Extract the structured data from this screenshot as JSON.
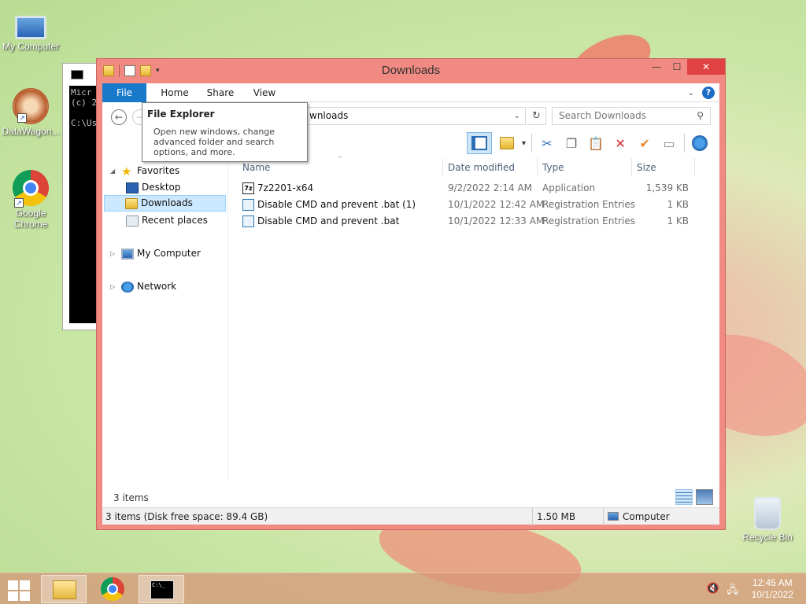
{
  "desktop": {
    "icons": [
      {
        "label": "My Computer",
        "icon": "computer-icon"
      },
      {
        "label": "DataWagon...",
        "icon": "datawagon-icon"
      },
      {
        "label": "Google Chrome",
        "icon": "chrome-icon"
      },
      {
        "label": "Recycle Bin",
        "icon": "recycle-bin-icon"
      }
    ]
  },
  "cmd_window": {
    "lines": [
      "Micr",
      "(c) 2",
      "",
      "C:\\Us"
    ]
  },
  "explorer": {
    "title": "Downloads",
    "window_buttons": {
      "minimize": "—",
      "maximize": "☐",
      "close": "✕"
    },
    "ribbon_tabs": [
      "File",
      "Home",
      "Share",
      "View"
    ],
    "address": "wnloads",
    "search_placeholder": "Search Downloads",
    "nav": {
      "favorites": "Favorites",
      "desktop": "Desktop",
      "downloads": "Downloads",
      "recent": "Recent places",
      "my_computer": "My Computer",
      "network": "Network"
    },
    "columns": [
      "Name",
      "Date modified",
      "Type",
      "Size"
    ],
    "files": [
      {
        "name": "7z2201-x64",
        "date": "9/2/2022 2:14 AM",
        "type": "Application",
        "size": "1,539 KB",
        "icon": "7zip-icon"
      },
      {
        "name": "Disable CMD and prevent .bat (1)",
        "date": "10/1/2022 12:42 AM",
        "type": "Registration Entries",
        "size": "1 KB",
        "icon": "registry-icon"
      },
      {
        "name": "Disable CMD and prevent .bat",
        "date": "10/1/2022 12:33 AM",
        "type": "Registration Entries",
        "size": "1 KB",
        "icon": "registry-icon"
      }
    ],
    "items_count": "3 items",
    "status": {
      "left": "3 items (Disk free space: 89.4 GB)",
      "size": "1.50 MB",
      "location": "Computer"
    },
    "tooltip": {
      "title": "File Explorer",
      "body": "Open new windows, change advanced folder and search options, and more."
    }
  },
  "taskbar": {
    "time": "12:45 AM",
    "date": "10/1/2022"
  },
  "colors": {
    "window_frame": "#f08a82",
    "file_tab": "#1979ca",
    "close_button": "#e04343",
    "selection": "#cce8ff"
  }
}
